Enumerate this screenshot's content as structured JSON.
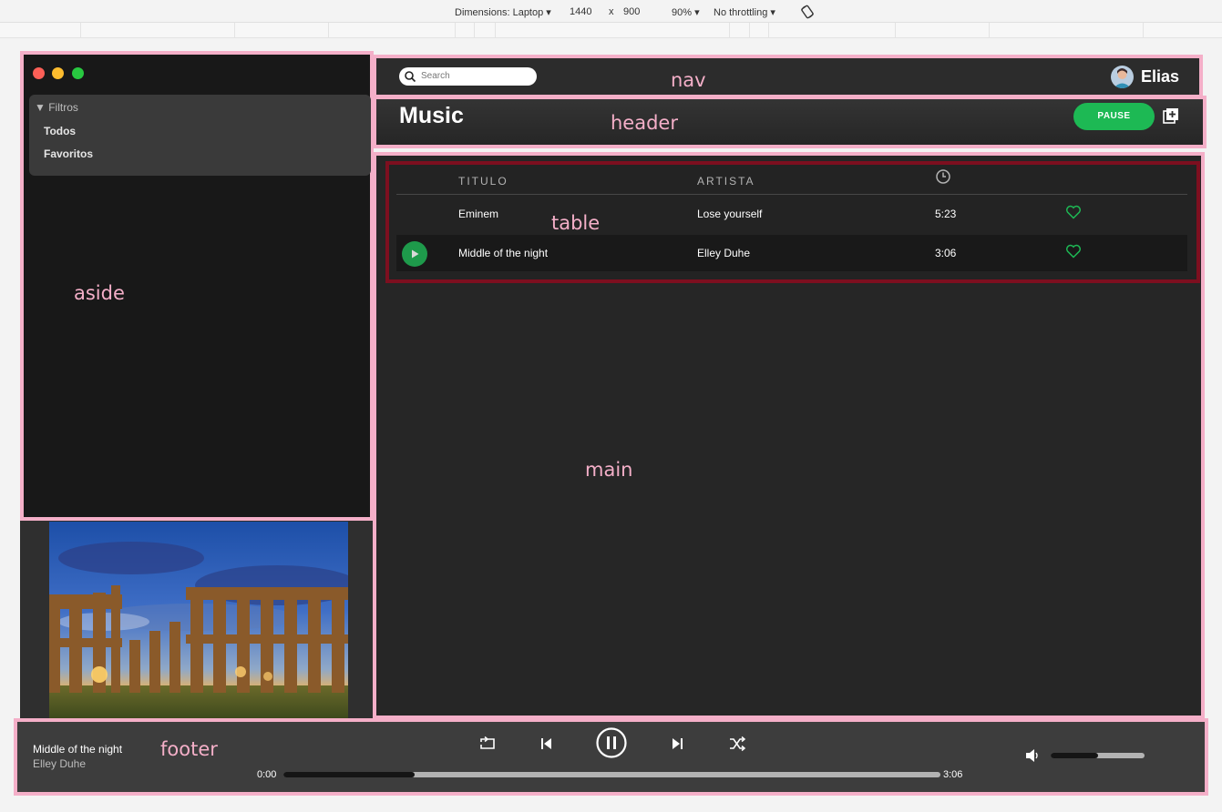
{
  "devtools": {
    "dimensions": "Dimensions: Laptop ▾",
    "width": "1440",
    "times": "x",
    "height": "900",
    "zoom": "90% ▾",
    "throttling": "No throttling ▾"
  },
  "labels": {
    "aside": "aside",
    "nav": "nav",
    "header": "header",
    "table": "table",
    "main": "main",
    "footer": "footer"
  },
  "aside": {
    "filters_title": "▼ Filtros",
    "items": [
      {
        "label": "Todos"
      },
      {
        "label": "Favoritos"
      }
    ]
  },
  "nav": {
    "search_placeholder": "Search",
    "user_name": "Elias"
  },
  "header": {
    "title": "Music",
    "pause_label": "PAUSE"
  },
  "table": {
    "columns": [
      "TITULO",
      "ARTISTA",
      "duration-clock-icon"
    ],
    "rows": [
      {
        "title": "Eminem",
        "artist": "Lose yourself",
        "duration": "5:23",
        "favorite": true,
        "playing": false
      },
      {
        "title": "Middle of the night",
        "artist": "Elley Duhe",
        "duration": "3:06",
        "favorite": true,
        "playing": true
      }
    ]
  },
  "footer": {
    "track_title": "Middle of the night",
    "track_artist": "Elley Duhe",
    "time_current": "0:00",
    "time_total": "3:06",
    "progress": 0.2,
    "volume": 0.5
  },
  "colors": {
    "accent": "#1db954",
    "outline": "#f4afc8",
    "table_outline": "#7d0f1f"
  }
}
